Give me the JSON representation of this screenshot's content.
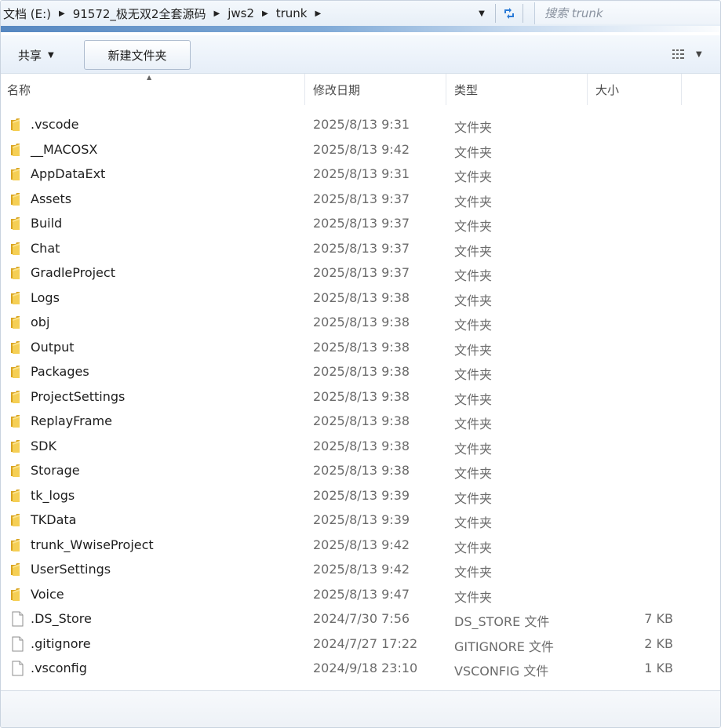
{
  "address": {
    "crumbs": [
      "文档 (E:)",
      "91572_极无双2全套源码",
      "jws2",
      "trunk"
    ],
    "search_placeholder": "搜索 trunk"
  },
  "toolbar": {
    "share_label": "共享",
    "new_folder_label": "新建文件夹"
  },
  "columns": {
    "name": "名称",
    "date": "修改日期",
    "type": "类型",
    "size": "大小"
  },
  "files": [
    {
      "name": ".vscode",
      "date": "2025/8/13 9:31",
      "type": "文件夹",
      "size": "",
      "kind": "folder"
    },
    {
      "name": "__MACOSX",
      "date": "2025/8/13 9:42",
      "type": "文件夹",
      "size": "",
      "kind": "folder"
    },
    {
      "name": "AppDataExt",
      "date": "2025/8/13 9:31",
      "type": "文件夹",
      "size": "",
      "kind": "folder"
    },
    {
      "name": "Assets",
      "date": "2025/8/13 9:37",
      "type": "文件夹",
      "size": "",
      "kind": "folder"
    },
    {
      "name": "Build",
      "date": "2025/8/13 9:37",
      "type": "文件夹",
      "size": "",
      "kind": "folder"
    },
    {
      "name": "Chat",
      "date": "2025/8/13 9:37",
      "type": "文件夹",
      "size": "",
      "kind": "folder"
    },
    {
      "name": "GradleProject",
      "date": "2025/8/13 9:37",
      "type": "文件夹",
      "size": "",
      "kind": "folder"
    },
    {
      "name": "Logs",
      "date": "2025/8/13 9:38",
      "type": "文件夹",
      "size": "",
      "kind": "folder"
    },
    {
      "name": "obj",
      "date": "2025/8/13 9:38",
      "type": "文件夹",
      "size": "",
      "kind": "folder"
    },
    {
      "name": "Output",
      "date": "2025/8/13 9:38",
      "type": "文件夹",
      "size": "",
      "kind": "folder"
    },
    {
      "name": "Packages",
      "date": "2025/8/13 9:38",
      "type": "文件夹",
      "size": "",
      "kind": "folder"
    },
    {
      "name": "ProjectSettings",
      "date": "2025/8/13 9:38",
      "type": "文件夹",
      "size": "",
      "kind": "folder"
    },
    {
      "name": "ReplayFrame",
      "date": "2025/8/13 9:38",
      "type": "文件夹",
      "size": "",
      "kind": "folder"
    },
    {
      "name": "SDK",
      "date": "2025/8/13 9:38",
      "type": "文件夹",
      "size": "",
      "kind": "folder"
    },
    {
      "name": "Storage",
      "date": "2025/8/13 9:38",
      "type": "文件夹",
      "size": "",
      "kind": "folder"
    },
    {
      "name": "tk_logs",
      "date": "2025/8/13 9:39",
      "type": "文件夹",
      "size": "",
      "kind": "folder"
    },
    {
      "name": "TKData",
      "date": "2025/8/13 9:39",
      "type": "文件夹",
      "size": "",
      "kind": "folder"
    },
    {
      "name": "trunk_WwiseProject",
      "date": "2025/8/13 9:42",
      "type": "文件夹",
      "size": "",
      "kind": "folder"
    },
    {
      "name": "UserSettings",
      "date": "2025/8/13 9:42",
      "type": "文件夹",
      "size": "",
      "kind": "folder"
    },
    {
      "name": "Voice",
      "date": "2025/8/13 9:47",
      "type": "文件夹",
      "size": "",
      "kind": "folder"
    },
    {
      "name": ".DS_Store",
      "date": "2024/7/30 7:56",
      "type": "DS_STORE 文件",
      "size": "7 KB",
      "kind": "file"
    },
    {
      "name": ".gitignore",
      "date": "2024/7/27 17:22",
      "type": "GITIGNORE 文件",
      "size": "2 KB",
      "kind": "file"
    },
    {
      "name": ".vsconfig",
      "date": "2024/9/18 23:10",
      "type": "VSCONFIG 文件",
      "size": "1 KB",
      "kind": "file"
    }
  ],
  "colors": {
    "folder_body": "#e8b830",
    "folder_front": "#f6d35c",
    "accent_blue": "#3c75b7"
  }
}
